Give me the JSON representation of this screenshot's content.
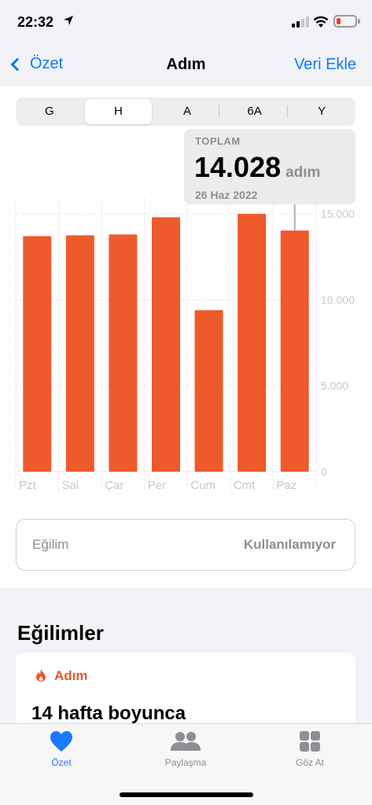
{
  "status": {
    "time": "22:32",
    "location_icon": "location-arrow-icon"
  },
  "nav": {
    "back_label": "Özet",
    "title": "Adım",
    "action_label": "Veri Ekle"
  },
  "segments": [
    "G",
    "H",
    "A",
    "6A",
    "Y"
  ],
  "tooltip": {
    "label": "TOPLAM",
    "value": "14.028",
    "unit": "adım",
    "date": "26 Haz 2022"
  },
  "chart_data": {
    "type": "bar",
    "categories": [
      "Pzt",
      "Sal",
      "Çar",
      "Per",
      "Cum",
      "Cmt",
      "Paz"
    ],
    "values": [
      13700,
      13750,
      13800,
      14800,
      9400,
      15000,
      14028
    ],
    "y_ticks": [
      "0",
      "5.000",
      "10.000",
      "15.000"
    ],
    "ylim": [
      0,
      15000
    ],
    "color": "#ee5a2b",
    "highlight_index": 6
  },
  "trend": {
    "label": "Eğilim",
    "value": "Kullanılamıyor"
  },
  "trends_section": {
    "title": "Eğilimler",
    "card_title": "Adım",
    "card_body": "14 hafta boyunca"
  },
  "tabs": [
    {
      "label": "Özet",
      "icon": "heart-icon"
    },
    {
      "label": "Paylaşma",
      "icon": "people-icon"
    },
    {
      "label": "Göz At",
      "icon": "grid-icon"
    }
  ],
  "colors": {
    "accent": "#0a7aff",
    "bar": "#ee5a2b"
  }
}
